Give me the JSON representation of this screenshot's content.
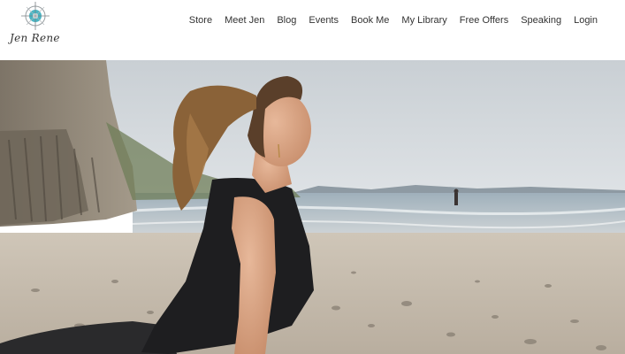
{
  "brand": {
    "logo_text": "Jen Rene",
    "accent": "#29a8b8"
  },
  "nav": {
    "items": [
      {
        "label": "Store"
      },
      {
        "label": "Meet Jen"
      },
      {
        "label": "Blog"
      },
      {
        "label": "Events"
      },
      {
        "label": "Book Me"
      },
      {
        "label": "My Library"
      },
      {
        "label": "Free Offers"
      },
      {
        "label": "Speaking"
      },
      {
        "label": "Login"
      }
    ]
  },
  "hero": {
    "image": "woman-yoga-on-beach"
  }
}
